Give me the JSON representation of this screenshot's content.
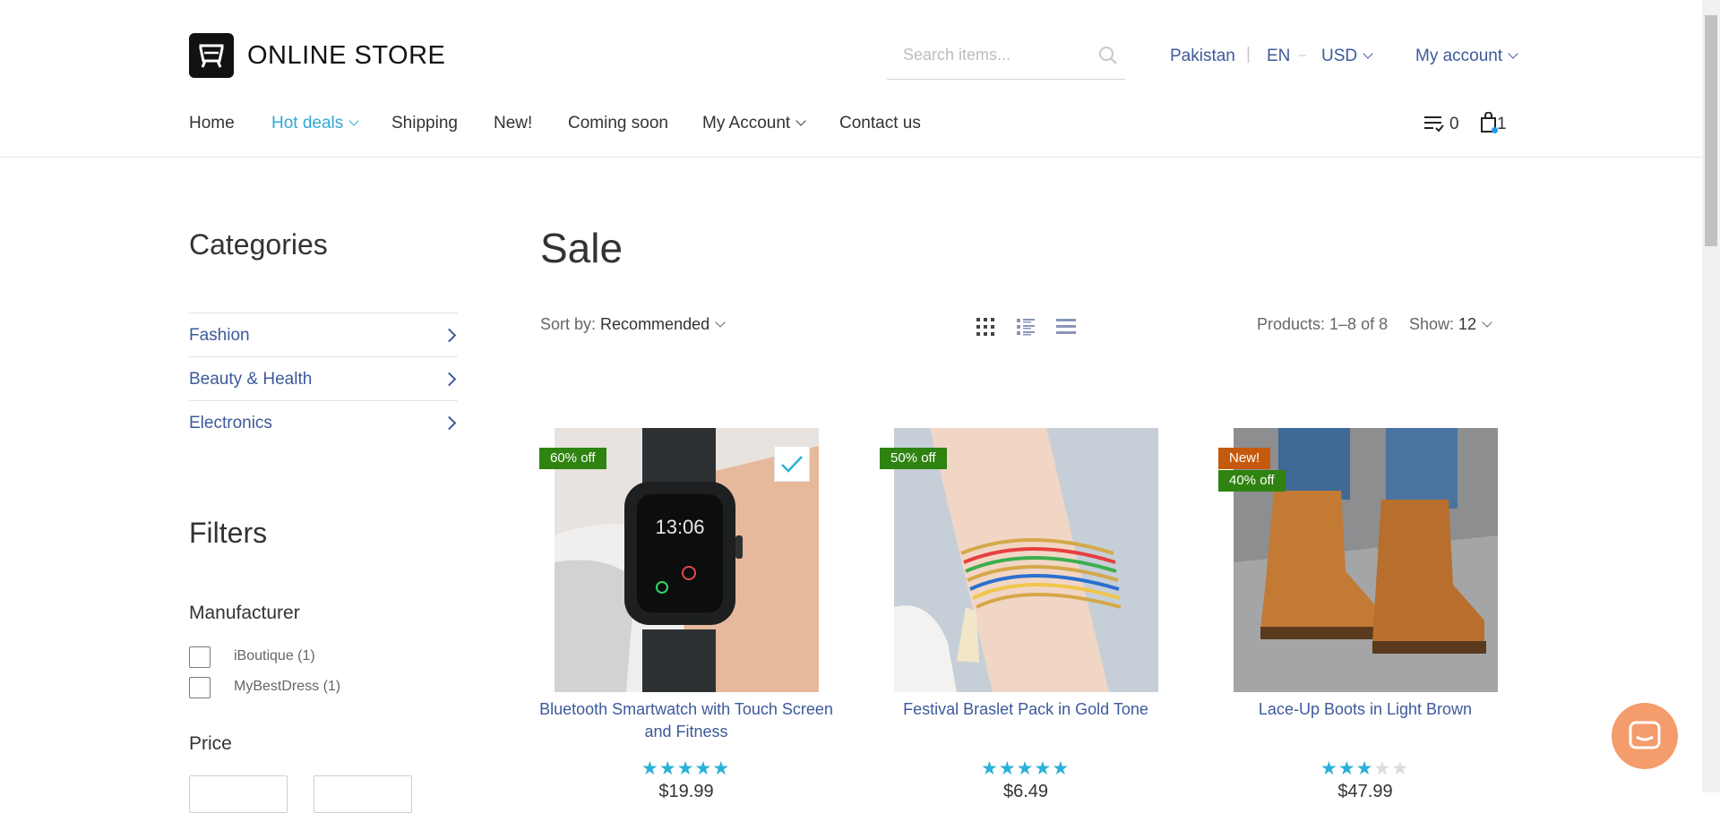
{
  "header": {
    "logo_text": "ONLINE STORE",
    "search": {
      "placeholder": "Search items..."
    },
    "country": "Pakistan",
    "language": "EN",
    "lang_sep": "–",
    "currency": "USD",
    "account": "My account",
    "wishlist_count": "0",
    "cart_count": "1"
  },
  "nav": {
    "items": [
      {
        "label": "Home"
      },
      {
        "label": "Hot deals"
      },
      {
        "label": "Shipping"
      },
      {
        "label": "New!"
      },
      {
        "label": "Coming soon"
      },
      {
        "label": "My Account"
      },
      {
        "label": "Contact us"
      }
    ]
  },
  "sidebar": {
    "categories_title": "Categories",
    "categories": [
      {
        "label": "Fashion"
      },
      {
        "label": "Beauty & Health"
      },
      {
        "label": "Electronics"
      }
    ],
    "filters_title": "Filters",
    "manufacturer_title": "Manufacturer",
    "manufacturers": [
      {
        "label": "iBoutique (1)"
      },
      {
        "label": "MyBestDress (1)"
      }
    ],
    "price_title": "Price"
  },
  "main": {
    "title": "Sale",
    "sort_label": "Sort by:",
    "sort_value": "Recommended",
    "products_count": "Products: 1–8 of 8",
    "show_label": "Show:",
    "show_value": "12"
  },
  "products": [
    {
      "name": "Bluetooth Smartwatch with Touch Screen and Fitness",
      "badges": [
        "60% off"
      ],
      "rating": 5,
      "price": "$19.99",
      "compare_checked": true
    },
    {
      "name": "Festival Braslet Pack in Gold Tone",
      "badges": [
        "50% off"
      ],
      "rating": 5,
      "price": "$6.49",
      "compare_checked": false
    },
    {
      "name": "Lace-Up Boots in Light Brown",
      "badges": [
        "New!",
        "40% off"
      ],
      "rating": 3,
      "price": "$47.99",
      "compare_checked": false
    }
  ],
  "colors": {
    "link": "#3c5a9a",
    "accent": "#30a8d8",
    "badge_sale": "#2f8311",
    "badge_new": "#c55a0d",
    "star": "#2ab1d6",
    "chat": "#f49c6b"
  },
  "icons": [
    "search-icon",
    "wishlist-icon",
    "cart-icon",
    "grid-view-icon",
    "list-view-icon",
    "table-view-icon",
    "chevron-right-icon",
    "checkmark-icon",
    "chat-icon"
  ]
}
